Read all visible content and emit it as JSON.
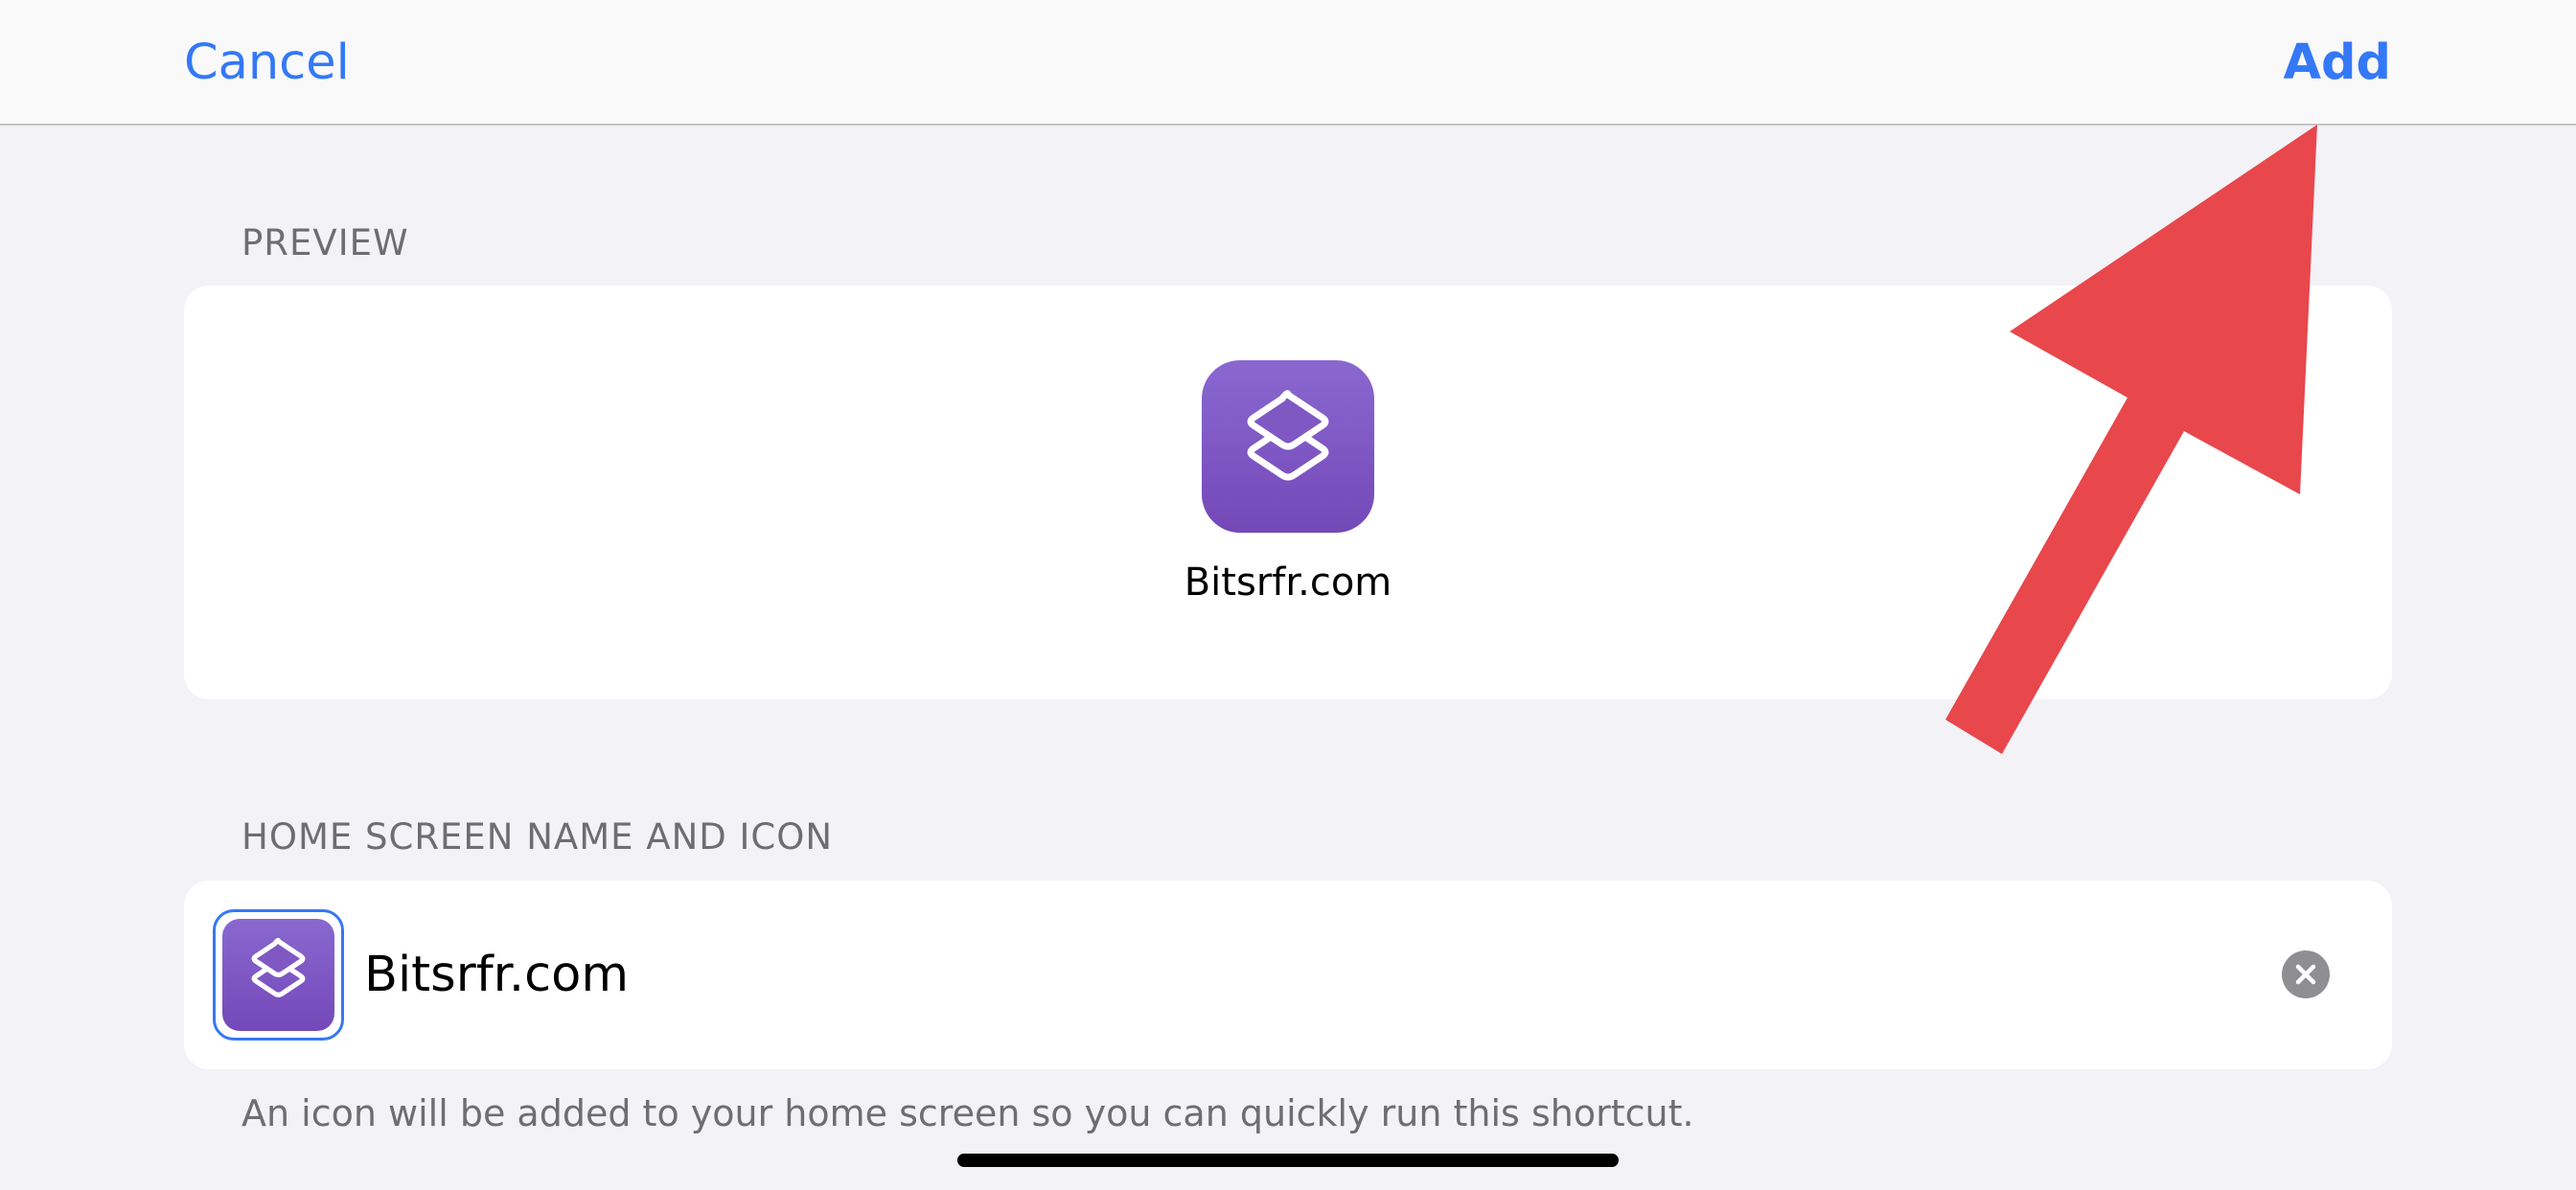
{
  "nav": {
    "cancel_label": "Cancel",
    "add_label": "Add"
  },
  "preview": {
    "header": "PREVIEW",
    "app_name": "Bitsrfr.com",
    "icon": "shortcuts-layers-icon"
  },
  "home_screen": {
    "header": "HOME SCREEN NAME AND ICON",
    "name_value": "Bitsrfr.com",
    "icon": "shortcuts-layers-icon",
    "clear_icon": "clear-x-icon",
    "footer": "An icon will be added to your home screen so you can quickly run this shortcut."
  },
  "annotation": {
    "type": "arrow",
    "color": "#e8474c",
    "points_to": "Add"
  },
  "colors": {
    "accent": "#3478f6",
    "icon_gradient_top": "#8a68d0",
    "icon_gradient_bottom": "#7448b8",
    "background": "#f2f2f7"
  }
}
